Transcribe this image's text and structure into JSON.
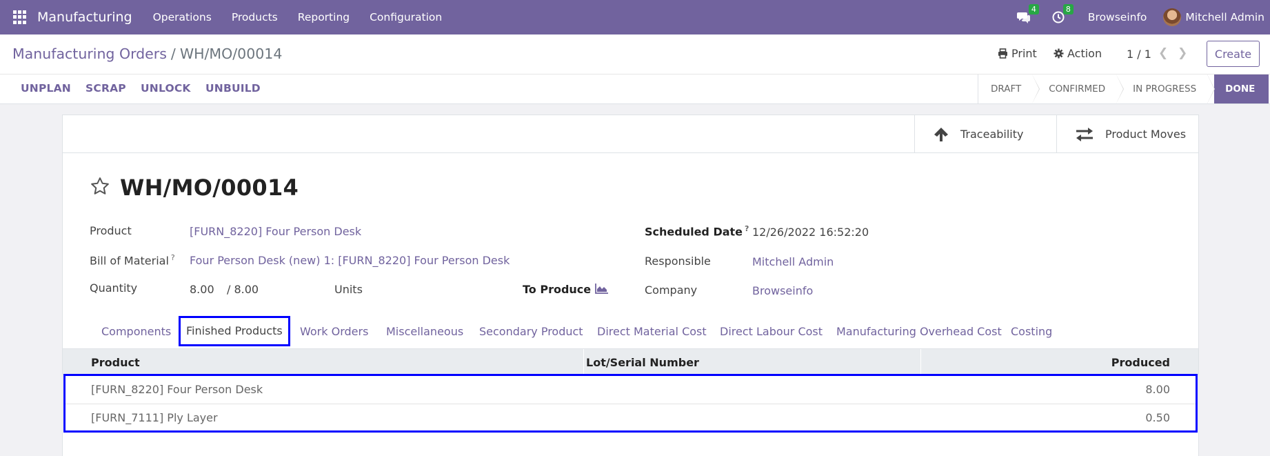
{
  "navbar": {
    "app_title": "Manufacturing",
    "menus": [
      "Operations",
      "Products",
      "Reporting",
      "Configuration"
    ],
    "messages_count": "4",
    "activities_count": "8",
    "company": "Browseinfo",
    "user": "Mitchell Admin"
  },
  "control_panel": {
    "breadcrumb_parent": "Manufacturing Orders",
    "breadcrumb_separator": "/",
    "breadcrumb_current": "WH/MO/00014",
    "print_label": "Print",
    "action_label": "Action",
    "pager_value": "1 / 1",
    "create_label": "Create",
    "actions": [
      "UNPLAN",
      "SCRAP",
      "UNLOCK",
      "UNBUILD"
    ],
    "stages": [
      "DRAFT",
      "CONFIRMED",
      "IN PROGRESS",
      "DONE"
    ],
    "active_stage": "DONE"
  },
  "smart_buttons": {
    "traceability": "Traceability",
    "product_moves": "Product Moves"
  },
  "record": {
    "name": "WH/MO/00014",
    "product_label": "Product",
    "product_value": "[FURN_8220] Four Person Desk",
    "bom_label": "Bill of Material",
    "bom_help": "?",
    "bom_value": "Four Person Desk (new) 1: [FURN_8220] Four Person Desk",
    "quantity_label": "Quantity",
    "quantity_value": "8.00",
    "quantity_produced": "/ 8.00",
    "uom": "Units",
    "to_produce_label": "To Produce",
    "scheduled_label": "Scheduled Date",
    "scheduled_help": "?",
    "scheduled_value": "12/26/2022 16:52:20",
    "responsible_label": "Responsible",
    "responsible_value": "Mitchell Admin",
    "company_label": "Company",
    "company_value": "Browseinfo"
  },
  "tabs": [
    "Components",
    "Finished Products",
    "Work Orders",
    "Miscellaneous",
    "Secondary Product",
    "Direct Material Cost",
    "Direct Labour Cost",
    "Manufacturing Overhead Cost",
    "Costing"
  ],
  "active_tab": "Finished Products",
  "table": {
    "columns": [
      "Product",
      "Lot/Serial Number",
      "Produced"
    ],
    "rows": [
      {
        "product": "[FURN_8220] Four Person Desk",
        "lot": "",
        "produced": "8.00"
      },
      {
        "product": "[FURN_7111] Ply Layer",
        "lot": "",
        "produced": "0.50"
      }
    ]
  },
  "colors": {
    "brand": "#71639e",
    "badge": "#28a745",
    "highlight": "#0000ff"
  }
}
